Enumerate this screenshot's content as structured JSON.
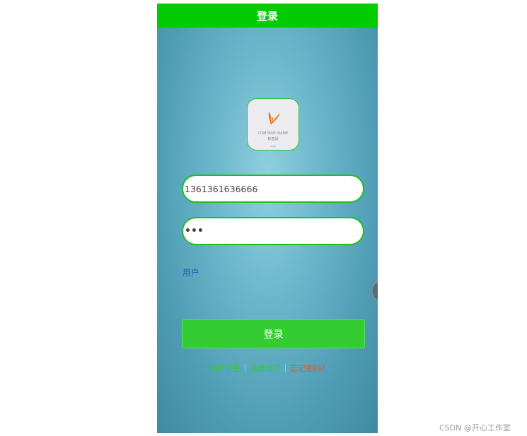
{
  "header": {
    "title": "登录"
  },
  "logo": {
    "company_text": "COMPANY NAME",
    "cn_text": "标志设"
  },
  "form": {
    "phone_value": "1361361636666",
    "password_value": "•••",
    "role_label": "用户",
    "login_button_label": "登录"
  },
  "links": {
    "register_student": "注册学生",
    "register_user": "注册用户",
    "forgot_password": "忘记密码?"
  },
  "watermark": "CSDN @开心工作室",
  "colors": {
    "header_green": "#00cc00",
    "button_green": "#33cc33",
    "link_green": "#2fcc2f",
    "link_red": "#e2543e",
    "role_blue": "#1a5fb4"
  }
}
